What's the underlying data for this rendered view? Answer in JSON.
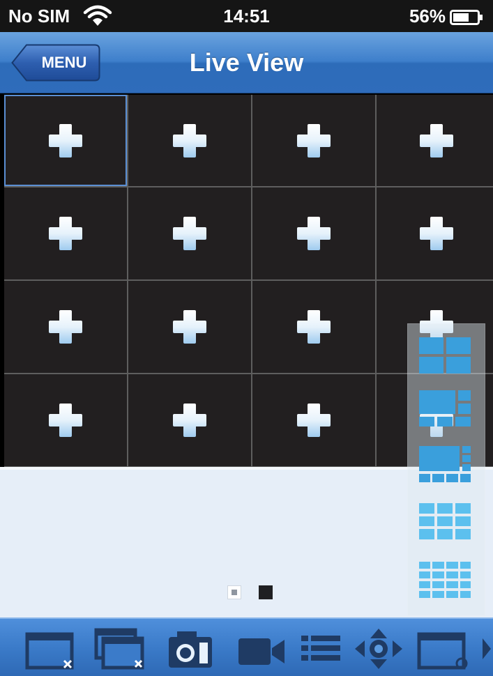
{
  "status_bar": {
    "carrier": "No SIM",
    "time": "14:51",
    "battery_percent": "56%",
    "icons": [
      "wifi-icon",
      "battery-icon"
    ]
  },
  "nav": {
    "menu_label": "MENU",
    "title": "Live View"
  },
  "grid": {
    "rows": 4,
    "columns": 4,
    "cell_icon": "plus-icon",
    "selected_cell": 0
  },
  "pager": {
    "pages": 2,
    "current_page": 1
  },
  "layout_options": [
    {
      "name": "layout-4-split-icon"
    },
    {
      "name": "layout-6-split-icon"
    },
    {
      "name": "layout-8-split-icon"
    },
    {
      "name": "layout-9-split-icon"
    },
    {
      "name": "layout-16-split-icon"
    }
  ],
  "toolbar": {
    "items": [
      {
        "name": "close-window-icon"
      },
      {
        "name": "close-all-windows-icon"
      },
      {
        "name": "snapshot-icon"
      },
      {
        "name": "record-icon"
      },
      {
        "name": "device-list-icon"
      },
      {
        "name": "ptz-icon"
      },
      {
        "name": "window-settings-icon"
      },
      {
        "name": "more-arrow-icon"
      }
    ]
  },
  "colors": {
    "nav_blue": "#3e7fcb",
    "cell_bg": "#221f20",
    "grid_line": "#5e5e5e",
    "plus_icon": "#dceefa",
    "layout_icon": "#4cb3ea",
    "toolbar_icon": "#1f3b64"
  }
}
